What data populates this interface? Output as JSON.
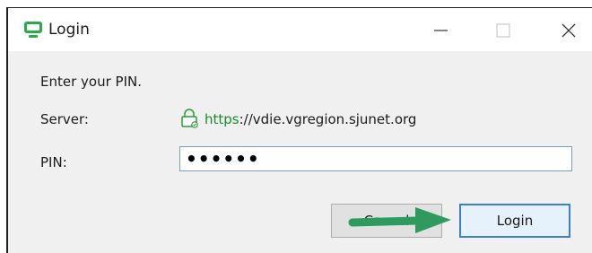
{
  "window": {
    "title": "Login"
  },
  "form": {
    "instruction": "Enter your PIN.",
    "server_label": "Server:",
    "server_url_protocol": "https",
    "server_url_rest": "://vdie.vgregion.sjunet.org",
    "pin_label": "PIN:",
    "pin_value": "••••••"
  },
  "buttons": {
    "cancel_label": "Cancel",
    "login_label": "Login"
  },
  "colors": {
    "app_icon": "#2aaa4a",
    "secure_url": "#1a8a2a",
    "arrow": "#2e9a5e",
    "focus_border": "#3d7fcf"
  },
  "icons": [
    "app-icon",
    "minimize-icon",
    "maximize-icon",
    "close-icon",
    "lock-icon",
    "arrow-annotation"
  ]
}
